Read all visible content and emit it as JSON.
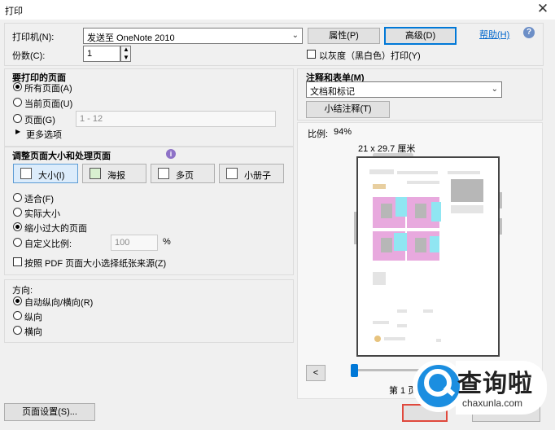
{
  "window": {
    "title": "打印"
  },
  "printer": {
    "label": "打印机(N):",
    "selected": "发送至 OneNote 2010",
    "properties_label": "属性(P)",
    "advanced_label": "高级(D)",
    "help_label": "帮助(H)"
  },
  "copies": {
    "label": "份数(C):",
    "value": "1"
  },
  "grayscale": {
    "label": "以灰度（黑白色）打印(Y)",
    "checked": false
  },
  "pages_section": {
    "title": "要打印的页面",
    "all_pages": "所有页面(A)",
    "current_page": "当前页面(U)",
    "pages": "页面(G)",
    "pages_placeholder": "1 - 12",
    "more_options": "更多选项",
    "selected": "all"
  },
  "sizing_section": {
    "title": "调整页面大小和处理页面",
    "tabs": [
      {
        "label": "大小(I)",
        "icon": "size-icon",
        "selected": true
      },
      {
        "label": "海报",
        "icon": "poster-icon",
        "selected": false
      },
      {
        "label": "多页",
        "icon": "multiple-pages-icon",
        "selected": false
      },
      {
        "label": "小册子",
        "icon": "booklet-icon",
        "selected": false
      }
    ],
    "fit": "适合(F)",
    "actual_size": "实际大小",
    "shrink_oversized": "缩小过大的页面",
    "custom_scale": "自定义比例:",
    "custom_scale_value": "100",
    "percent": "%",
    "paper_source": "按照 PDF 页面大小选择纸张来源(Z)",
    "selected": "shrink"
  },
  "orientation": {
    "title": "方向:",
    "auto": "自动纵向/横向(R)",
    "portrait": "纵向",
    "landscape": "横向",
    "selected": "auto"
  },
  "comments": {
    "title": "注释和表单(M)",
    "selected": "文档和标记",
    "summarize_label": "小结注释(T)"
  },
  "preview": {
    "scale_label": "比例:",
    "scale_value": "94%",
    "paper_size": "21 x 29.7 厘米",
    "prev_label": "<",
    "page_indicator": "第 1 页"
  },
  "footer": {
    "page_setup_label": "页面设置(S)..."
  },
  "watermark": {
    "text_cn": "查询啦",
    "text_en": "chaxunla.com"
  },
  "colors": {
    "accent": "#0078d7",
    "link": "#0066cc",
    "watermark_blue": "#1b8ee0"
  }
}
